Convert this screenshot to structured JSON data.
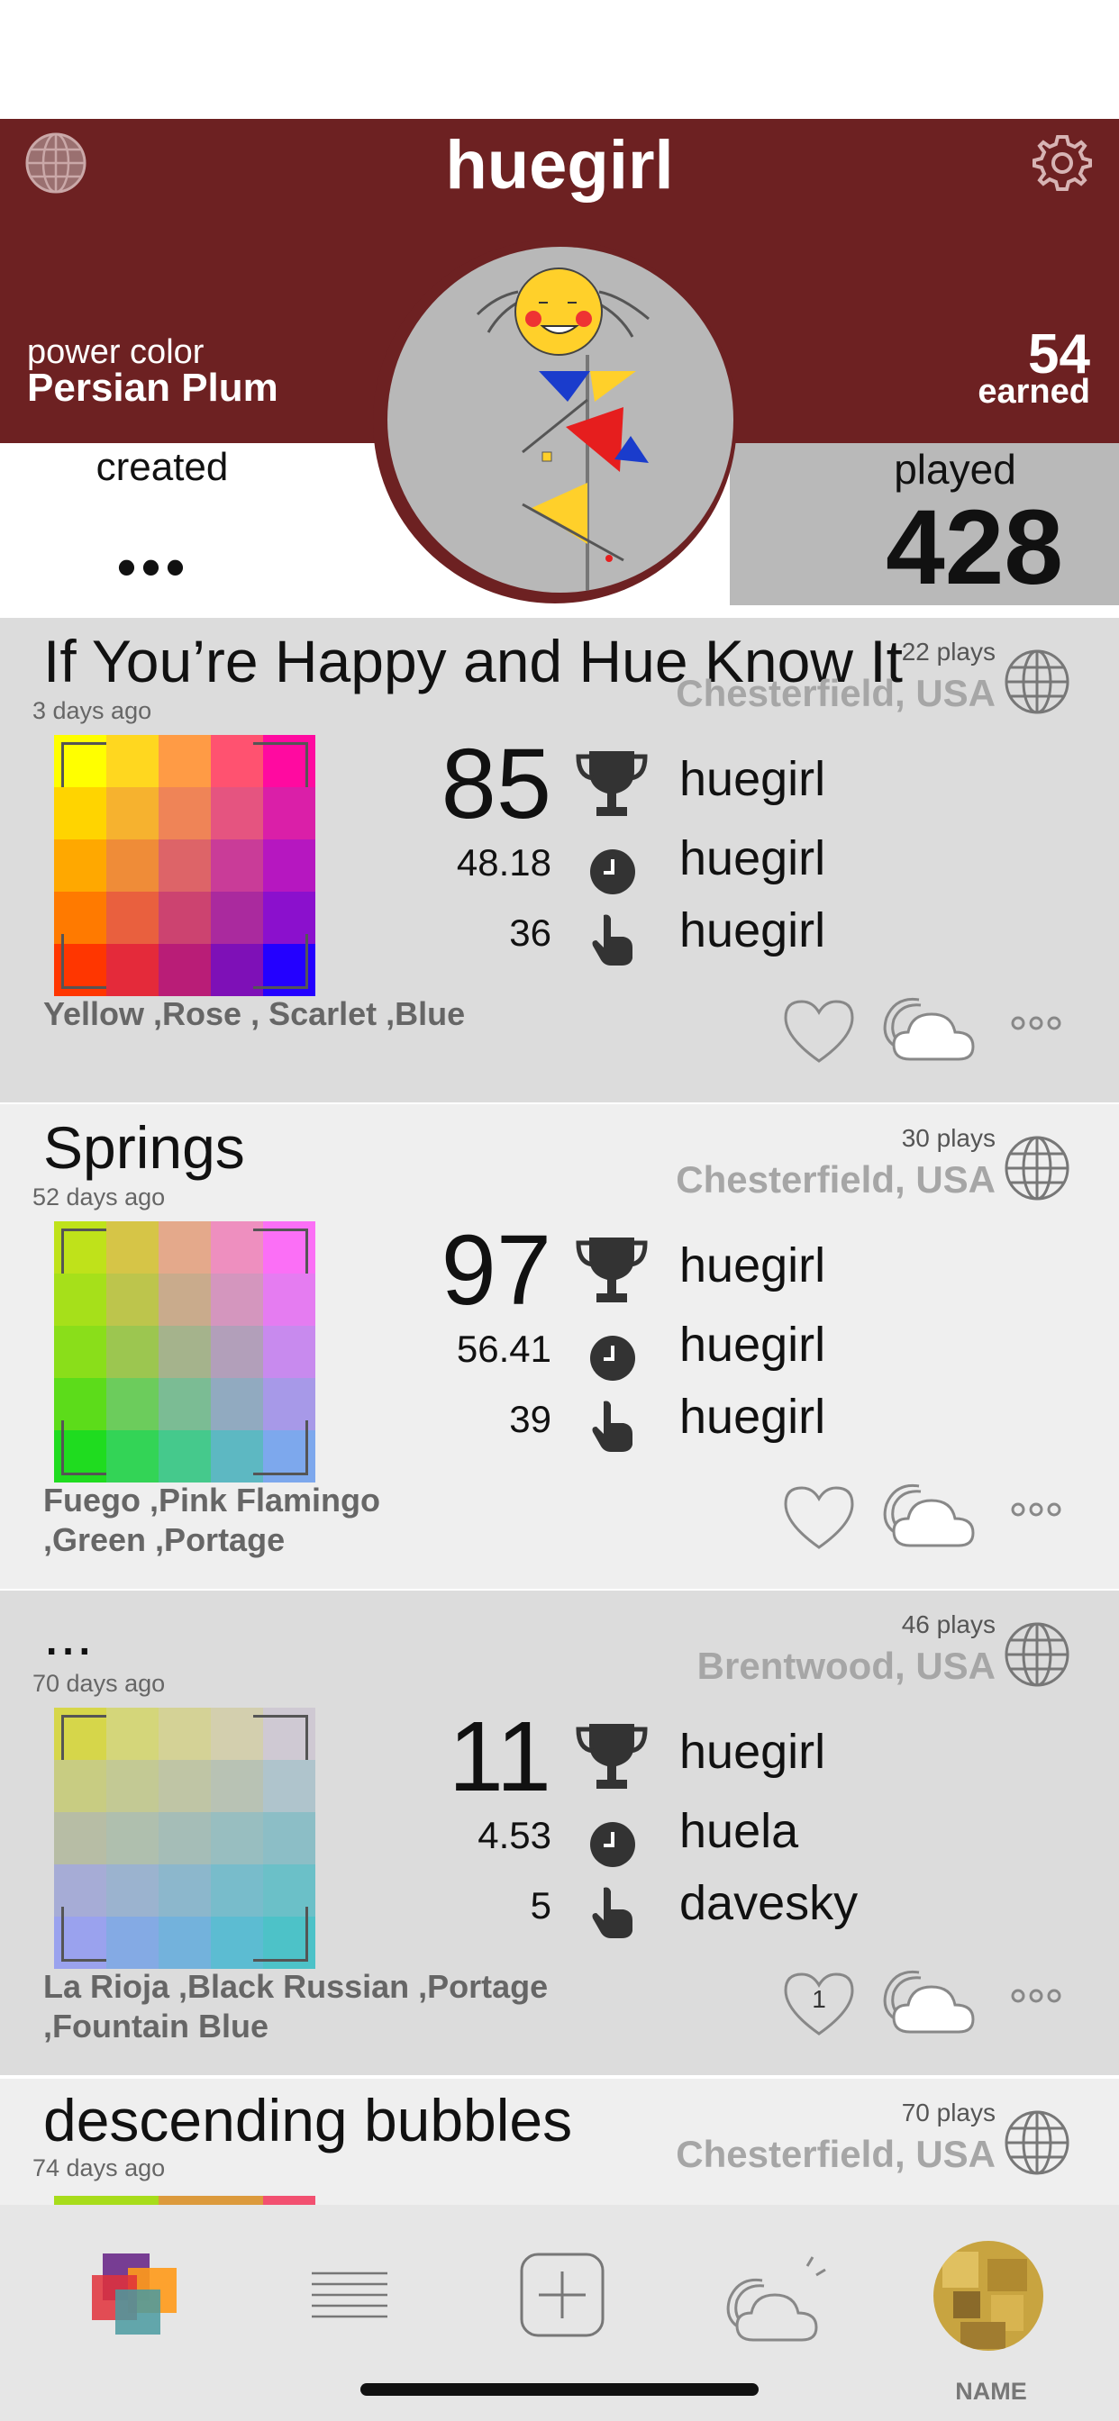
{
  "profile": {
    "username": "huegirl",
    "power_color_label": "power color",
    "power_color_name": "Persian Plum",
    "earned_value": "54",
    "earned_label": "earned",
    "created_label": "created",
    "created_value": "•••",
    "played_label": "played",
    "played_value": "428",
    "header_color": "#6d2122"
  },
  "cards": [
    {
      "title": "If You’re Happy and Hue Know It",
      "ago": "3 days ago",
      "plays": "22 plays",
      "location": "Chesterfield, USA",
      "score": "85",
      "time": "48.18",
      "moves": "36",
      "score_user": "huegirl",
      "time_user": "huegirl",
      "moves_user": "huegirl",
      "colors_text": "Yellow ,Rose , Scarlet ,Blue",
      "likes": "",
      "palette": [
        [
          "#ffff00",
          "#ffd71f",
          "#ff9b45",
          "#ff5270",
          "#ff0aa0"
        ],
        [
          "#ffd400",
          "#f6b22f",
          "#ef8457",
          "#e55480",
          "#da1fa8"
        ],
        [
          "#ffa800",
          "#ef8c38",
          "#dd6468",
          "#c93c98",
          "#b617c0"
        ],
        [
          "#ff7a00",
          "#e9603e",
          "#cc4370",
          "#aa2a9e",
          "#8b10cd"
        ],
        [
          "#ff3600",
          "#e42a3a",
          "#b91d77",
          "#7e10b7",
          "#2400ff"
        ]
      ]
    },
    {
      "title": "Springs",
      "ago": "52 days ago",
      "plays": "30 plays",
      "location": "Chesterfield, USA",
      "score": "97",
      "time": "56.41",
      "moves": "39",
      "score_user": "huegirl",
      "time_user": "huegirl",
      "moves_user": "huegirl",
      "colors_text": "Fuego ,Pink Flamingo ,Green ,Portage",
      "likes": "",
      "palette": [
        [
          "#bfe21a",
          "#d6c547",
          "#e4a98b",
          "#ee8fbf",
          "#fb6ff6"
        ],
        [
          "#a6e01a",
          "#bdc54c",
          "#c9ab8c",
          "#d496be",
          "#e57cf1"
        ],
        [
          "#8ade1a",
          "#9cc650",
          "#a5b38c",
          "#b29fba",
          "#c88aee"
        ],
        [
          "#5cdc1a",
          "#6ccc5c",
          "#7bbc94",
          "#91aac0",
          "#a799e8"
        ],
        [
          "#1fdc1f",
          "#33d456",
          "#45c98c",
          "#5db8c2",
          "#7da8ed"
        ]
      ]
    },
    {
      "title": "...",
      "ago": "70 days ago",
      "plays": "46 plays",
      "location": "Brentwood, USA",
      "score": "11",
      "time": "4.53",
      "moves": "5",
      "score_user": "huegirl",
      "time_user": "huela",
      "moves_user": "davesky",
      "colors_text": "La Rioja ,Black Russian ,Portage ,Fountain Blue",
      "likes": "1",
      "palette": [
        [
          "#d6d64a",
          "#d4d67a",
          "#d4d296",
          "#d3cfae",
          "#cfc9d3"
        ],
        [
          "#c8cc82",
          "#c3c994",
          "#bfc5a5",
          "#b8c2b4",
          "#afc4cc"
        ],
        [
          "#b7bda5",
          "#afbfae",
          "#a5bdb7",
          "#98bec0",
          "#8cbec6"
        ],
        [
          "#a6acd6",
          "#9bb3cf",
          "#8cb7cc",
          "#78bccb",
          "#6bc0c8"
        ],
        [
          "#9aa2ee",
          "#84aae4",
          "#73b2dc",
          "#5cbcd2",
          "#4dc2c8"
        ]
      ]
    }
  ],
  "partial_card": {
    "title": "descending bubbles",
    "ago": "74 days ago",
    "plays": "70 plays",
    "location": "Chesterfield, USA"
  },
  "tabbar": {
    "name_label": "NAME"
  }
}
